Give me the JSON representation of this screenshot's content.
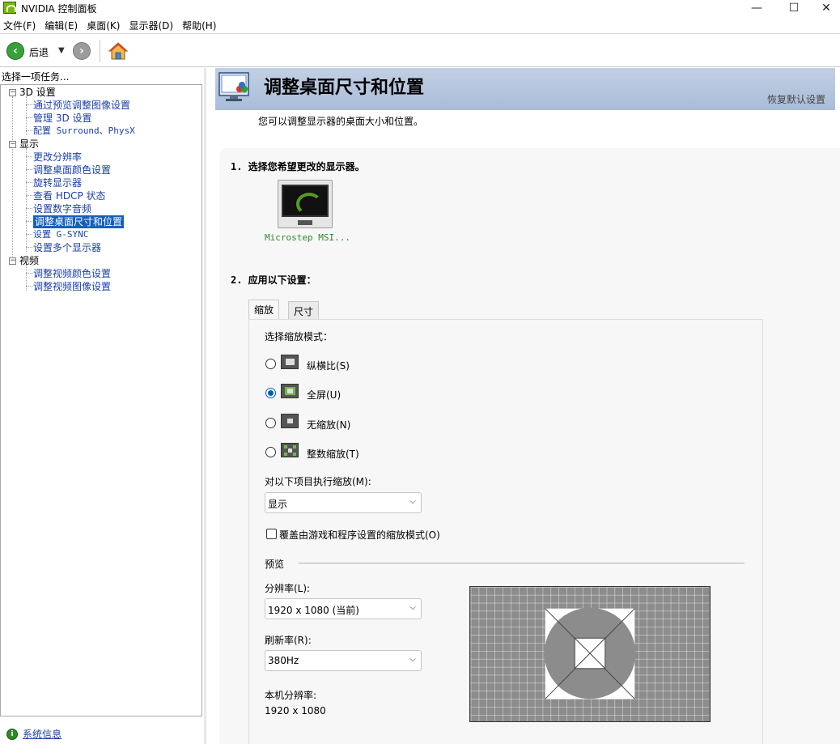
{
  "window": {
    "title": "NVIDIA 控制面板",
    "minimize_glyph": "—",
    "maximize_glyph": "☐",
    "close_glyph": "✕"
  },
  "menubar": {
    "items": [
      "文件(F)",
      "编辑(E)",
      "桌面(K)",
      "显示器(D)",
      "帮助(H)"
    ]
  },
  "toolbar": {
    "back_label": "后退",
    "back_icon": "back-arrow-icon",
    "forward_icon": "forward-arrow-icon",
    "home_icon": "home-icon"
  },
  "sidebar": {
    "header": "选择一项任务...",
    "tree": [
      {
        "label": "3D 设置",
        "children": [
          "通过预览调整图像设置",
          "管理 3D 设置",
          "配置 Surround、PhysX"
        ]
      },
      {
        "label": "显示",
        "children": [
          "更改分辨率",
          "调整桌面颜色设置",
          "旋转显示器",
          "查看 HDCP 状态",
          "设置数字音频",
          "调整桌面尺寸和位置",
          "设置 G-SYNC",
          "设置多个显示器"
        ]
      },
      {
        "label": "视频",
        "children": [
          "调整视频颜色设置",
          "调整视频图像设置"
        ]
      }
    ],
    "selected": "调整桌面尺寸和位置",
    "footer_link": "系统信息"
  },
  "main": {
    "title": "调整桌面尺寸和位置",
    "restore_defaults": "恢复默认设置",
    "description": "您可以调整显示器的桌面大小和位置。",
    "step1": "1. 选择您希望更改的显示器。",
    "monitor_label": "Microstep MSI...",
    "step2": "2. 应用以下设置：",
    "tabs": [
      "缩放",
      "尺寸"
    ],
    "active_tab": "缩放",
    "scaling": {
      "mode_label": "选择缩放模式：",
      "options": [
        "纵横比(S)",
        "全屏(U)",
        "无缩放(N)",
        "整数缩放(T)"
      ],
      "selected": "全屏(U)",
      "perform_on_label": "对以下项目执行缩放(M):",
      "perform_on_value": "显示",
      "override_label": "覆盖由游戏和程序设置的缩放模式(O)",
      "override_checked": false
    },
    "preview": {
      "label": "预览",
      "resolution_label": "分辨率(L):",
      "resolution_value": "1920 x 1080 (当前)",
      "refresh_label": "刷新率(R):",
      "refresh_value": "380Hz",
      "native_label": "本机分辨率:",
      "native_value": "1920 x 1080"
    }
  }
}
